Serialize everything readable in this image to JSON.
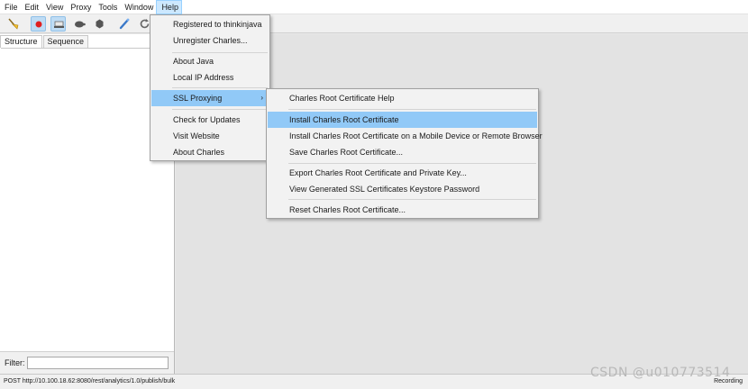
{
  "menubar": {
    "items": [
      "File",
      "Edit",
      "View",
      "Proxy",
      "Tools",
      "Window",
      "Help"
    ]
  },
  "toolbar": {
    "icons": [
      "broom-icon",
      "record-icon",
      "throttle-icon",
      "turtle-icon",
      "hexagon-icon",
      "pen-icon",
      "refresh-icon"
    ]
  },
  "left_pane": {
    "tabs": [
      "Structure",
      "Sequence"
    ],
    "filter_label": "Filter:",
    "filter_value": ""
  },
  "help_menu": {
    "items": [
      "Registered to thinkinjava",
      "Unregister Charles...",
      "About Java",
      "Local IP Address",
      "SSL Proxying",
      "Check for Updates",
      "Visit Website",
      "About Charles"
    ],
    "submenu_arrow": "›"
  },
  "ssl_menu": {
    "items": [
      "Charles Root Certificate Help",
      "Install Charles Root Certificate",
      "Install Charles Root Certificate on a Mobile Device or Remote Browser",
      "Save Charles Root Certificate...",
      "Export Charles Root Certificate and Private Key...",
      "View Generated SSL Certificates Keystore Password",
      "Reset Charles Root Certificate..."
    ]
  },
  "statusbar": {
    "text": "POST http://10.100.18.62:8080/rest/analytics/1.0/publish/bulk",
    "recording": "Recording"
  },
  "watermark": "CSDN @u010773514",
  "colors": {
    "menu_highlight": "#91c9f7",
    "menubar_active": "#cce8ff",
    "record_red": "#e02020"
  }
}
